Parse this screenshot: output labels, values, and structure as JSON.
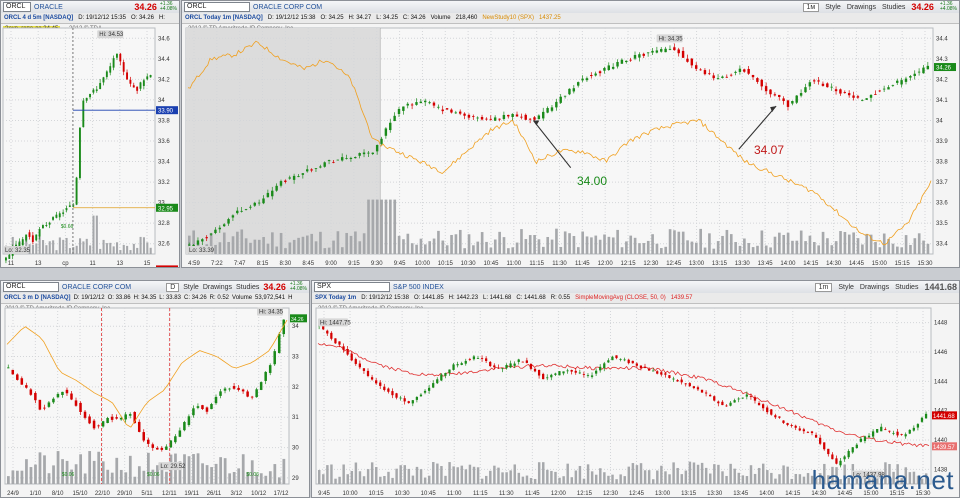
{
  "panes": {
    "daily": {
      "symbol": "ORCL",
      "company": "ORACLE",
      "price": "34.26",
      "chg1": "+1.36",
      "chg2": "+4.08%",
      "info_title": "ORCL 4 d 5m [NASDAQ]",
      "info_d": "D: 19/12/12 15:35",
      "info_o": "O: 34.26",
      "info_h": "H:",
      "gap_label": "Закр. гэпа до 34.45",
      "copyright": "2012 © TDA",
      "hi_label": "Hi: 34.53",
      "lo_label": "Lo: 32.35",
      "vol_label": "$0.66",
      "price_badges": [
        {
          "v": "33.90",
          "c": "#1a3fb0"
        },
        {
          "v": "32.95",
          "c": "#1a8a1a"
        },
        {
          "v": "32.35",
          "c": "#d40000"
        }
      ],
      "y_ticks": [
        "34.6",
        "34.4",
        "34.2",
        "34",
        "33.8",
        "33.6",
        "33.4",
        "33.2",
        "33",
        "32.8",
        "32.6"
      ],
      "x_ticks": [
        "11",
        "13",
        "ср",
        "11",
        "13",
        "15"
      ]
    },
    "intraday": {
      "symbol": "ORCL",
      "company": "ORACLE CORP COM",
      "price": "34.26",
      "chg1": "+1.36",
      "chg2": "+4.08%",
      "btn_period": "1м",
      "btn_style": "Style",
      "btn_drawings": "Drawings",
      "btn_studies": "Studies",
      "info_title": "ORCL Today 1m [NASDAQ]",
      "info_d": "D: 19/12/12 15:38",
      "info_o": "O: 34.25",
      "info_h": "H: 34.27",
      "info_l": "L: 34.25",
      "info_c": "C: 34.26",
      "info_vol": "Volume",
      "info_vol_v": "218,460",
      "info_ind": "NewStudy10 (SPX)",
      "info_ind_v": "1437.25",
      "copyright": "2012 © TD Ameritrade IP Company, Inc.",
      "hi_label": "Hi: 34.35",
      "lo_label": "Lo: 33.39",
      "ann1": "34.00",
      "ann2": "34.07",
      "price_badge": "34.26",
      "y_ticks": [
        "34.4",
        "34.3",
        "34.2",
        "34.1",
        "34",
        "33.9",
        "33.8",
        "33.7",
        "33.6",
        "33.5",
        "33.4"
      ],
      "x_ticks": [
        "4:59",
        "7:22",
        "7:47",
        "8:15",
        "8:30",
        "8:45",
        "9:00",
        "9:15",
        "9:30",
        "9:45",
        "10:00",
        "10:15",
        "10:30",
        "10:45",
        "11:00",
        "11:15",
        "11:30",
        "11:45",
        "12:00",
        "12:15",
        "12:30",
        "12:45",
        "13:00",
        "13:15",
        "13:30",
        "13:45",
        "14:00",
        "14:15",
        "14:30",
        "14:45",
        "15:00",
        "15:15",
        "15:30"
      ]
    },
    "three_month": {
      "symbol": "ORCL",
      "company": "ORACLE CORP COM",
      "price": "34.26",
      "chg1": "+1.36",
      "chg2": "+4.08%",
      "btn_period": "D",
      "btn_style": "Style",
      "btn_drawings": "Drawings",
      "btn_studies": "Studies",
      "info_title": "ORCL 3 m D [NASDAQ]",
      "info_d": "D: 19/12/12",
      "info_o": "O: 33.86",
      "info_h": "H: 34.35",
      "info_l": "L: 33.83",
      "info_c": "C: 34.26",
      "info_r": "R: 0.52",
      "info_vol": "Volume",
      "info_vol_v": "53,972,541",
      "info_h2": "H",
      "copyright": "2012 © TD Ameritrade IP Company, Inc.",
      "hi_label": "Hi: 34.35",
      "lo_label": "Lo: 29.52",
      "vol1": "$0.06",
      "vol2": "$0.06",
      "vol3": "$0.06",
      "price_badge": "34.26",
      "y_ticks": [
        "34",
        "33",
        "32",
        "31",
        "30",
        "29"
      ],
      "x_ticks": [
        "24/9",
        "1/10",
        "8/10",
        "15/10",
        "22/10",
        "29/10",
        "5/11",
        "12/11",
        "19/11",
        "26/11",
        "3/12",
        "10/12",
        "17/12"
      ]
    },
    "spx": {
      "symbol": "SPX",
      "company": "S&P 500 INDEX",
      "price": "1441.68",
      "btn_period": "1m",
      "btn_style": "Style",
      "btn_drawings": "Drawings",
      "btn_studies": "Studies",
      "info_title": "SPX Today 1m",
      "info_d": "D: 19/12/12 15:38",
      "info_o": "O: 1441.85",
      "info_h": "H: 1442.23",
      "info_l": "L: 1441.68",
      "info_c": "C: 1441.68",
      "info_r": "R: 0.55",
      "info_ind": "SimpleMovingAvg (CLOSE, 50, 0)",
      "info_ind_v": "1439.57",
      "copyright": "2012 © TD Ameritrade IP Company, Inc.",
      "hi_label": "Hi: 1447.75",
      "lo_label": "Lo: 1437.98",
      "price_badge": "1441.68",
      "sma_badge": "1439.57",
      "y_ticks": [
        "1448",
        "1446",
        "1444",
        "1442",
        "1440",
        "1438"
      ],
      "x_ticks": [
        "9:45",
        "10:00",
        "10:15",
        "10:30",
        "10:45",
        "11:00",
        "11:15",
        "11:30",
        "11:45",
        "12:00",
        "12:15",
        "12:30",
        "12:45",
        "13:00",
        "13:15",
        "13:30",
        "13:45",
        "14:00",
        "14:15",
        "14:30",
        "14:45",
        "15:00",
        "15:15",
        "15:30"
      ]
    }
  },
  "watermark": "hamana.net",
  "colors": {
    "up": "#1a8a1a",
    "down": "#d40000",
    "overlay": "#f0a020",
    "sma": "#e03030",
    "blue_line": "#1a3fb0"
  },
  "chart_data": [
    {
      "type": "line",
      "title": "ORCL 4 d 5m [NASDAQ]",
      "ylim": [
        32.5,
        34.7
      ],
      "y_ticks": [
        34.6,
        34.4,
        34.2,
        34,
        33.8,
        33.6,
        33.4,
        33.2,
        33,
        32.8,
        32.6
      ],
      "x_ticks": [
        "11",
        "13",
        "ср",
        "11",
        "13",
        "15"
      ],
      "series": [
        {
          "values": [
            32.45,
            32.55,
            32.6,
            32.7,
            32.62,
            32.75,
            32.8,
            32.85,
            32.9,
            32.95,
            33.0,
            34.0,
            34.05,
            34.1,
            34.2,
            34.3,
            34.45,
            34.3,
            34.15,
            34.1,
            34.2,
            34.26
          ]
        }
      ],
      "levels": [
        33.9,
        32.95,
        32.35
      ],
      "annotations": [
        "Hi: 34.53",
        "Lo: 32.35",
        "Закр. гэпа до 34.45"
      ]
    },
    {
      "type": "line",
      "title": "ORCL Today 1m [NASDAQ]",
      "ylim": [
        33.35,
        34.45
      ],
      "y_ticks": [
        34.4,
        34.3,
        34.2,
        34.1,
        34,
        33.9,
        33.8,
        33.7,
        33.6,
        33.5,
        33.4
      ],
      "x_ticks": [
        "4:59",
        "7:22",
        "7:47",
        "8:15",
        "8:30",
        "8:45",
        "9:00",
        "9:15",
        "9:30",
        "9:45",
        "10:00",
        "10:15",
        "10:30",
        "10:45",
        "11:00",
        "11:15",
        "11:30",
        "11:45",
        "12:00",
        "12:15",
        "12:30",
        "12:45",
        "13:00",
        "13:15",
        "13:30",
        "13:45",
        "14:00",
        "14:15",
        "14:30",
        "14:45",
        "15:00",
        "15:15",
        "15:30"
      ],
      "series": [
        {
          "name": "ORCL",
          "values": [
            33.39,
            33.45,
            33.55,
            33.6,
            33.7,
            33.75,
            33.8,
            33.82,
            33.85,
            34.05,
            34.1,
            34.05,
            34.02,
            34.0,
            34.03,
            34.0,
            34.1,
            34.2,
            34.25,
            34.3,
            34.33,
            34.35,
            34.25,
            34.2,
            34.25,
            34.15,
            34.07,
            34.2,
            34.15,
            34.1,
            34.15,
            34.2,
            34.26
          ]
        },
        {
          "name": "NewStudy10 (SPX)",
          "values": [
            34.15,
            34.3,
            34.32,
            34.38,
            34.3,
            34.25,
            34.3,
            34.2,
            33.9,
            33.85,
            33.8,
            33.75,
            33.85,
            33.95,
            34.0,
            33.8,
            33.85,
            33.85,
            33.8,
            33.9,
            33.95,
            33.98,
            34.0,
            33.9,
            33.8,
            33.75,
            33.7,
            33.65,
            33.55,
            33.45,
            33.4,
            33.5,
            33.7
          ]
        }
      ],
      "annotations": [
        "Hi: 34.35",
        "Lo: 33.39",
        "34.00",
        "34.07"
      ]
    },
    {
      "type": "line",
      "title": "ORCL 3 m D [NASDAQ]",
      "ylim": [
        28.8,
        34.6
      ],
      "y_ticks": [
        34,
        33,
        32,
        31,
        30,
        29
      ],
      "x_ticks": [
        "24/9",
        "1/10",
        "8/10",
        "15/10",
        "22/10",
        "29/10",
        "5/11",
        "12/11",
        "19/11",
        "26/11",
        "3/12",
        "10/12",
        "17/12"
      ],
      "series": [
        {
          "values": [
            32.6,
            32.2,
            31.8,
            31.2,
            31.6,
            31.9,
            31.5,
            31.0,
            30.6,
            31.0,
            30.9,
            31.2,
            30.4,
            30.0,
            29.9,
            30.3,
            30.8,
            31.4,
            31.2,
            31.8,
            32.0,
            31.9,
            31.6,
            32.2,
            32.9,
            34.26
          ]
        }
      ],
      "annotations": [
        "Hi: 34.35",
        "Lo: 29.52"
      ]
    },
    {
      "type": "line",
      "title": "SPX Today 1m",
      "ylim": [
        1437.0,
        1449.0
      ],
      "y_ticks": [
        1448,
        1446,
        1444,
        1442,
        1440,
        1438
      ],
      "x_ticks": [
        "9:45",
        "10:00",
        "10:15",
        "10:30",
        "10:45",
        "11:00",
        "11:15",
        "11:30",
        "11:45",
        "12:00",
        "12:15",
        "12:30",
        "12:45",
        "13:00",
        "13:15",
        "13:30",
        "13:45",
        "14:00",
        "14:15",
        "14:30",
        "14:45",
        "15:00",
        "15:15",
        "15:30"
      ],
      "series": [
        {
          "name": "SPX",
          "values": [
            1447.75,
            1446.3,
            1444.6,
            1443.3,
            1442.5,
            1443.8,
            1445.1,
            1445.7,
            1444.8,
            1445.5,
            1444.2,
            1444.8,
            1444.3,
            1445.7,
            1445.2,
            1444.6,
            1444.0,
            1443.3,
            1442.3,
            1443.1,
            1441.9,
            1440.9,
            1440.4,
            1438.3,
            1439.9,
            1440.8,
            1440.2,
            1441.68
          ]
        },
        {
          "name": "SimpleMovingAvg (CLOSE, 50, 0)",
          "values": [
            1446.6,
            1446.3,
            1445.6,
            1445.0,
            1444.6,
            1444.4,
            1444.5,
            1444.7,
            1444.9,
            1445.0,
            1445.1,
            1445.0,
            1444.9,
            1444.9,
            1444.9,
            1444.8,
            1444.5,
            1444.2,
            1443.7,
            1443.1,
            1442.5,
            1441.9,
            1441.2,
            1440.6,
            1440.2,
            1439.9,
            1439.7,
            1439.57
          ]
        }
      ],
      "annotations": [
        "Hi: 1447.75",
        "Lo: 1437.98"
      ]
    }
  ]
}
